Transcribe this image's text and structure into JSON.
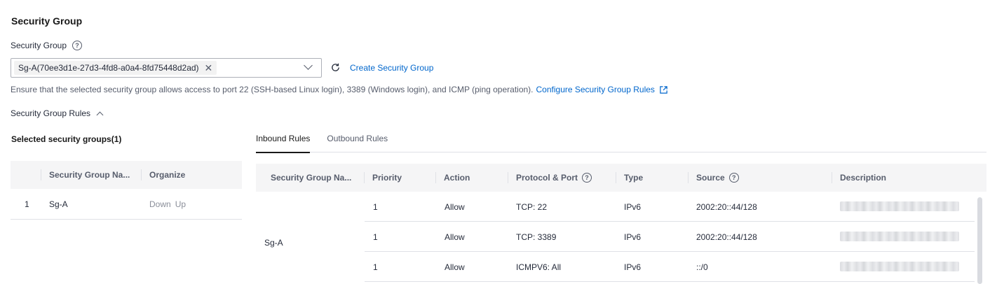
{
  "section": {
    "title": "Security Group"
  },
  "field": {
    "label": "Security Group",
    "help_icon": "question-circle-icon"
  },
  "select": {
    "tag_label": "Sg-A(70ee3d1e-27d3-4fd8-a0a4-8fd75448d2ad)",
    "tag_close_icon": "close-icon",
    "caret_icon": "chevron-down-icon"
  },
  "actions": {
    "refresh_icon": "refresh-icon",
    "create_label": "Create Security Group"
  },
  "hint": {
    "text": "Ensure that the selected security group allows access to port 22 (SSH-based Linux login), 3389 (Windows login), and ICMP (ping operation).",
    "link_label": "Configure Security Group Rules",
    "link_icon": "external-link-icon"
  },
  "rules_toggle": {
    "label": "Security Group Rules",
    "icon": "chevron-up-icon"
  },
  "left_panel": {
    "title": "Selected security groups(1)",
    "columns": [
      "",
      "Security Group Na...",
      "Organize"
    ],
    "rows": [
      {
        "index": "1",
        "name": "Sg-A",
        "down": "Down",
        "up": "Up"
      }
    ]
  },
  "tabs": [
    {
      "label": "Inbound Rules",
      "active": true
    },
    {
      "label": "Outbound Rules",
      "active": false
    }
  ],
  "rules_table": {
    "columns": {
      "group": "Security Group Na...",
      "priority": "Priority",
      "action": "Action",
      "protocol": "Protocol & Port",
      "type": "Type",
      "source": "Source",
      "description": "Description"
    },
    "group_name": "Sg-A",
    "rows": [
      {
        "priority": "1",
        "action": "Allow",
        "protocol": "TCP: 22",
        "type": "IPv6",
        "source": "2002:20::44/128"
      },
      {
        "priority": "1",
        "action": "Allow",
        "protocol": "TCP: 3389",
        "type": "IPv6",
        "source": "2002:20::44/128"
      },
      {
        "priority": "1",
        "action": "Allow",
        "protocol": "ICMPV6: All",
        "type": "IPv6",
        "source": "::/0"
      }
    ]
  },
  "colors": {
    "link": "#0066cc",
    "header_bg": "#f5f5f6",
    "border": "#dfe1e6"
  }
}
